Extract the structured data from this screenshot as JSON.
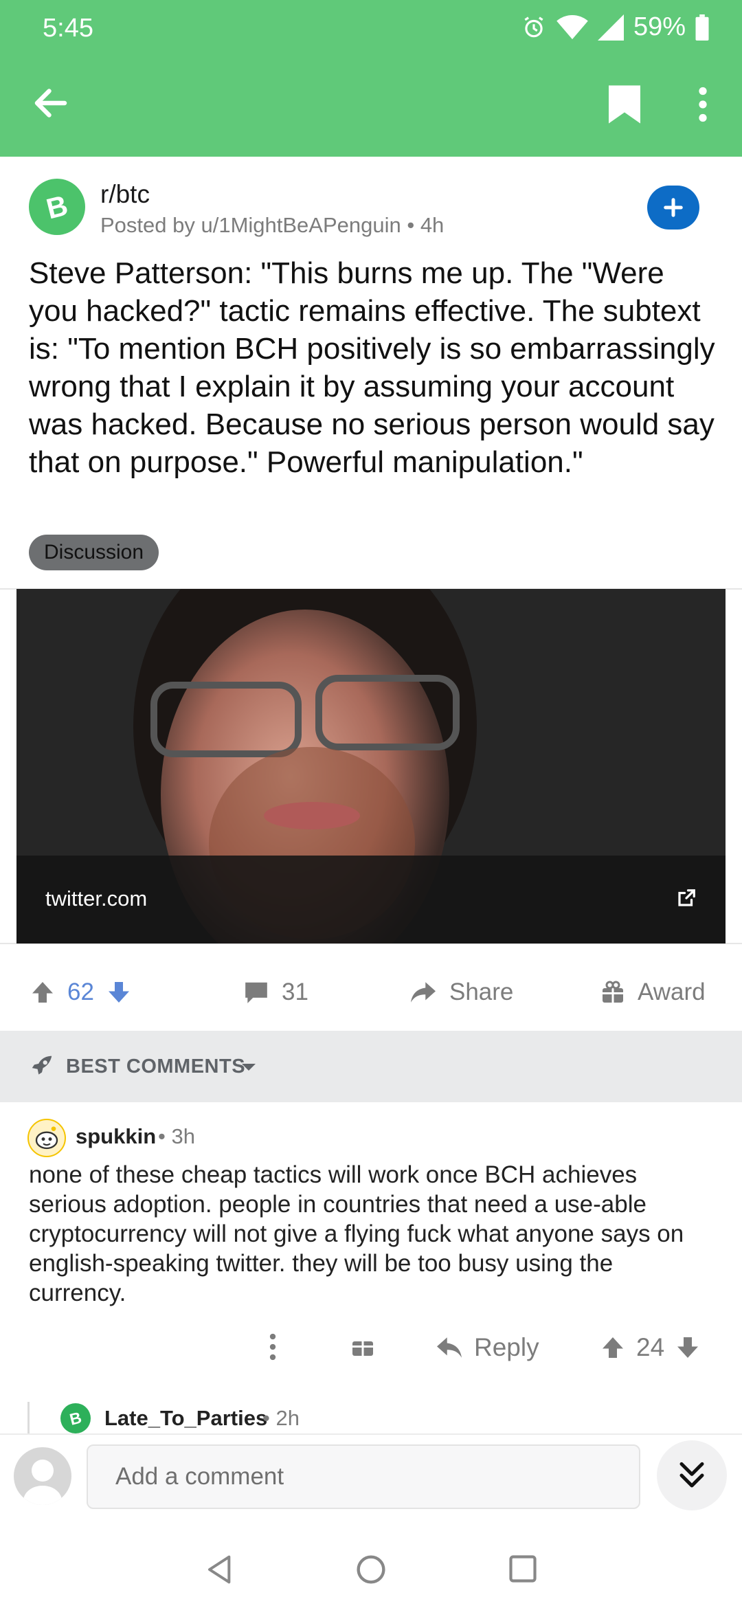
{
  "status_bar": {
    "time": "5:45",
    "battery": "59%"
  },
  "app_bar": {
    "icons": [
      "back-arrow-icon",
      "bookmark-icon",
      "more-vert-icon"
    ]
  },
  "post": {
    "subreddit": "r/btc",
    "posted_by": "Posted by u/1MightBeAPenguin • 4h",
    "title": "Steve Patterson: \"This burns me up. The \"Were you hacked?\" tactic remains effective. The subtext is: \"To mention BCH positively is so embarrassingly wrong that I explain it by assuming your account was hacked. Because no serious person would say that on purpose.\" Powerful manipulation.\"",
    "flair": "Discussion",
    "link_domain": "twitter.com",
    "score": "62",
    "comments": "31",
    "share_label": "Share",
    "award_label": "Award"
  },
  "sort": {
    "label": "BEST COMMENTS"
  },
  "comment": {
    "author": "spukkin",
    "meta": "• 3h",
    "body": "none of these cheap tactics will work once BCH achieves serious adoption. people in countries that need a use-able cryptocurrency will not give a flying fuck what anyone says on english-speaking twitter. they will be too busy using the currency.",
    "reply_label": "Reply",
    "score": "24"
  },
  "reply_preview": {
    "author": "Late_To_Parties",
    "meta": "• 2h"
  },
  "composer": {
    "placeholder": "Add a comment"
  },
  "colors": {
    "app_bar": "#60c979",
    "join_button": "#0d6cc6",
    "upvote_active": "#5a86d6"
  }
}
